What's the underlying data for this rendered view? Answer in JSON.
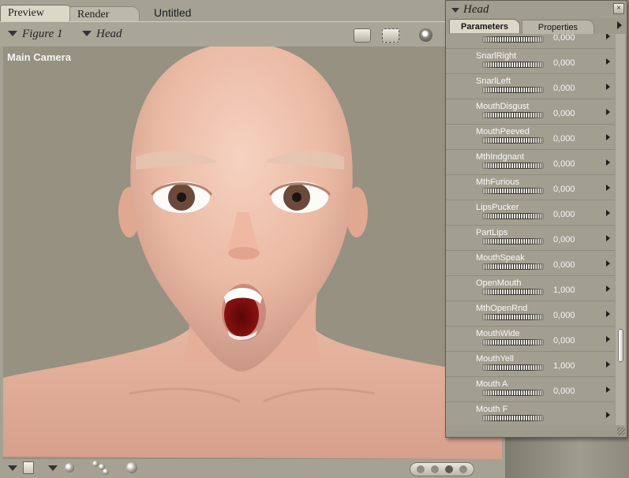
{
  "doc_tabs": [
    "Preview",
    "Render",
    "Untitled"
  ],
  "toolbar": {
    "figure_selector": "Figure 1",
    "part_selector": "Head"
  },
  "viewport": {
    "camera_label": "Main Camera"
  },
  "panel": {
    "title": "Head",
    "tabs": [
      "Parameters",
      "Properties"
    ],
    "params": [
      {
        "name": "",
        "value": "0,000"
      },
      {
        "name": "SnarlRight",
        "value": "0,000"
      },
      {
        "name": "SnarlLeft",
        "value": "0,000"
      },
      {
        "name": "MouthDisgust",
        "value": "0,000"
      },
      {
        "name": "MouthPeeved",
        "value": "0,000"
      },
      {
        "name": "MthIndgnant",
        "value": "0,000"
      },
      {
        "name": "MthFurious",
        "value": "0,000"
      },
      {
        "name": "LipsPucker",
        "value": "0,000"
      },
      {
        "name": "PartLips",
        "value": "0,000"
      },
      {
        "name": "MouthSpeak",
        "value": "0,000"
      },
      {
        "name": "OpenMouth",
        "value": "1,000"
      },
      {
        "name": "MthOpenRnd",
        "value": "0,000"
      },
      {
        "name": "MouthWide",
        "value": "0,000"
      },
      {
        "name": "MouthYell",
        "value": "1,000"
      },
      {
        "name": "Mouth A",
        "value": "0,000"
      },
      {
        "name": "Mouth F",
        "value": ""
      }
    ]
  },
  "icons": {
    "camera_1": "camera-icon",
    "camera_2": "camera-dashed-icon",
    "eye": "eye-icon",
    "close": "close-icon",
    "menu": "triangle-down-icon"
  }
}
